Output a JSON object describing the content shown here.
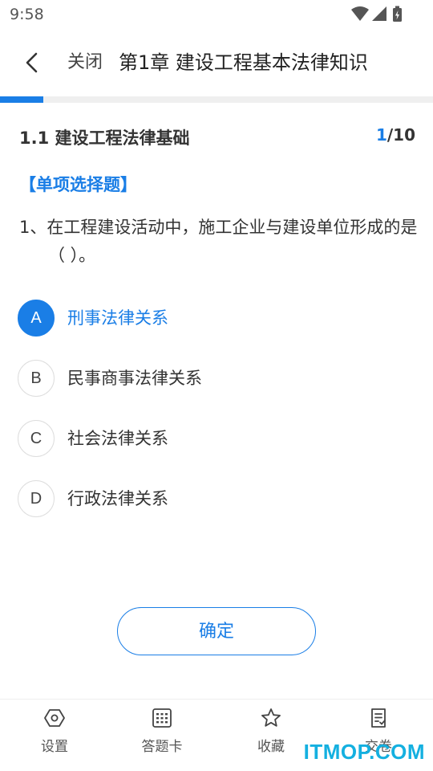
{
  "status_bar": {
    "time": "9:58",
    "icons": [
      "wifi-icon",
      "signal-icon",
      "battery-charging-icon"
    ]
  },
  "header": {
    "back_icon": "chevron-left-icon",
    "close_label": "关闭",
    "title": "第1章 建设工程基本法律知识"
  },
  "progress": {
    "fraction": 0.1
  },
  "section": {
    "title": "1.1 建设工程法律基础",
    "current": "1",
    "total": "/10"
  },
  "question": {
    "type_label": "【单项选择题】",
    "text": "1、在工程建设活动中，施工企业与建设单位形成的是（ ）。",
    "options": [
      {
        "letter": "A",
        "text": "刑事法律关系",
        "selected": true
      },
      {
        "letter": "B",
        "text": "民事商事法律关系",
        "selected": false
      },
      {
        "letter": "C",
        "text": "社会法律关系",
        "selected": false
      },
      {
        "letter": "D",
        "text": "行政法律关系",
        "selected": false
      }
    ]
  },
  "confirm_label": "确定",
  "bottom_nav": [
    {
      "icon": "hexagon-settings-icon",
      "label": "设置"
    },
    {
      "icon": "grid-card-icon",
      "label": "答题卡"
    },
    {
      "icon": "star-icon",
      "label": "收藏"
    },
    {
      "icon": "submit-paper-icon",
      "label": "交卷"
    }
  ],
  "watermark": "ITMOP.COM",
  "colors": {
    "accent": "#1a7ee6",
    "watermark": "#14b0e0"
  }
}
